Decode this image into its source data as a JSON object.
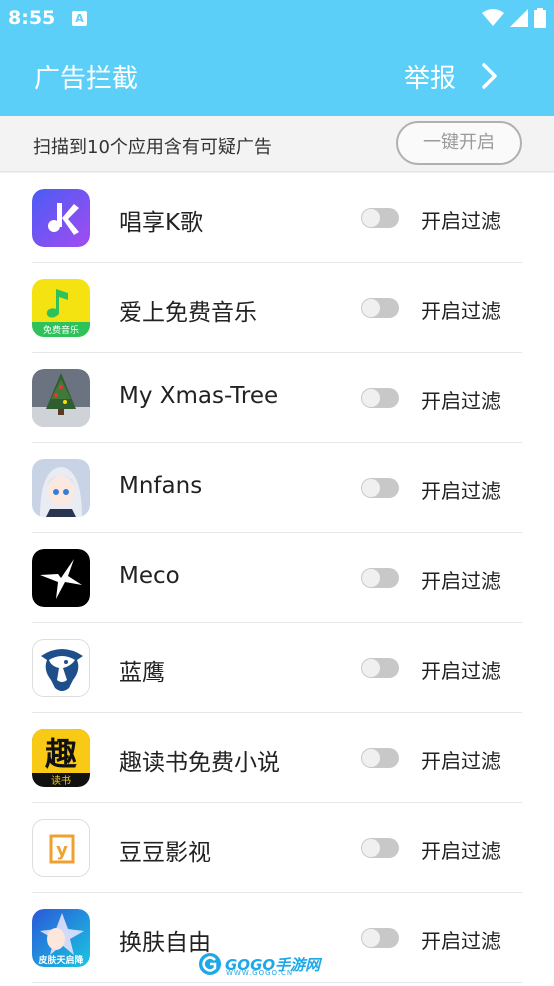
{
  "status_bar": {
    "time": "8:55",
    "notification_glyph": "A"
  },
  "header": {
    "title": "广告拦截",
    "report_label": "举报"
  },
  "scan": {
    "summary": "扫描到10个应用含有可疑广告",
    "one_key_button": "一键开启"
  },
  "apps": [
    {
      "name": "唱享K歌",
      "filter_label": "开启过滤",
      "filter_on": false,
      "icon": "k-song-icon"
    },
    {
      "name": "爱上免费音乐",
      "filter_label": "开启过滤",
      "filter_on": false,
      "icon": "music-note-icon",
      "icon_caption": "免费音乐"
    },
    {
      "name": "My Xmas-Tree",
      "filter_label": "开启过滤",
      "filter_on": false,
      "icon": "christmas-tree-icon"
    },
    {
      "name": "Mnfans",
      "filter_label": "开启过滤",
      "filter_on": false,
      "icon": "anime-girl-icon"
    },
    {
      "name": "Meco",
      "filter_label": "开启过滤",
      "filter_on": false,
      "icon": "meco-star-icon"
    },
    {
      "name": "蓝鹰",
      "filter_label": "开启过滤",
      "filter_on": false,
      "icon": "eagle-icon"
    },
    {
      "name": "趣读书免费小说",
      "filter_label": "开启过滤",
      "filter_on": false,
      "icon": "qu-reading-icon",
      "icon_glyph": "趣",
      "icon_caption": "读书"
    },
    {
      "name": "豆豆影视",
      "filter_label": "开启过滤",
      "filter_on": false,
      "icon": "doudou-video-icon",
      "icon_glyph": "y"
    },
    {
      "name": "换肤自由",
      "filter_label": "开启过滤",
      "filter_on": false,
      "icon": "skin-game-icon",
      "icon_caption": "皮肤天启降"
    }
  ],
  "watermark": {
    "brand": "GOGO手游网",
    "url": "WWW.GOGO.CN"
  },
  "colors": {
    "accent": "#5ccff8",
    "toggle_off": "#c8c8c8"
  }
}
